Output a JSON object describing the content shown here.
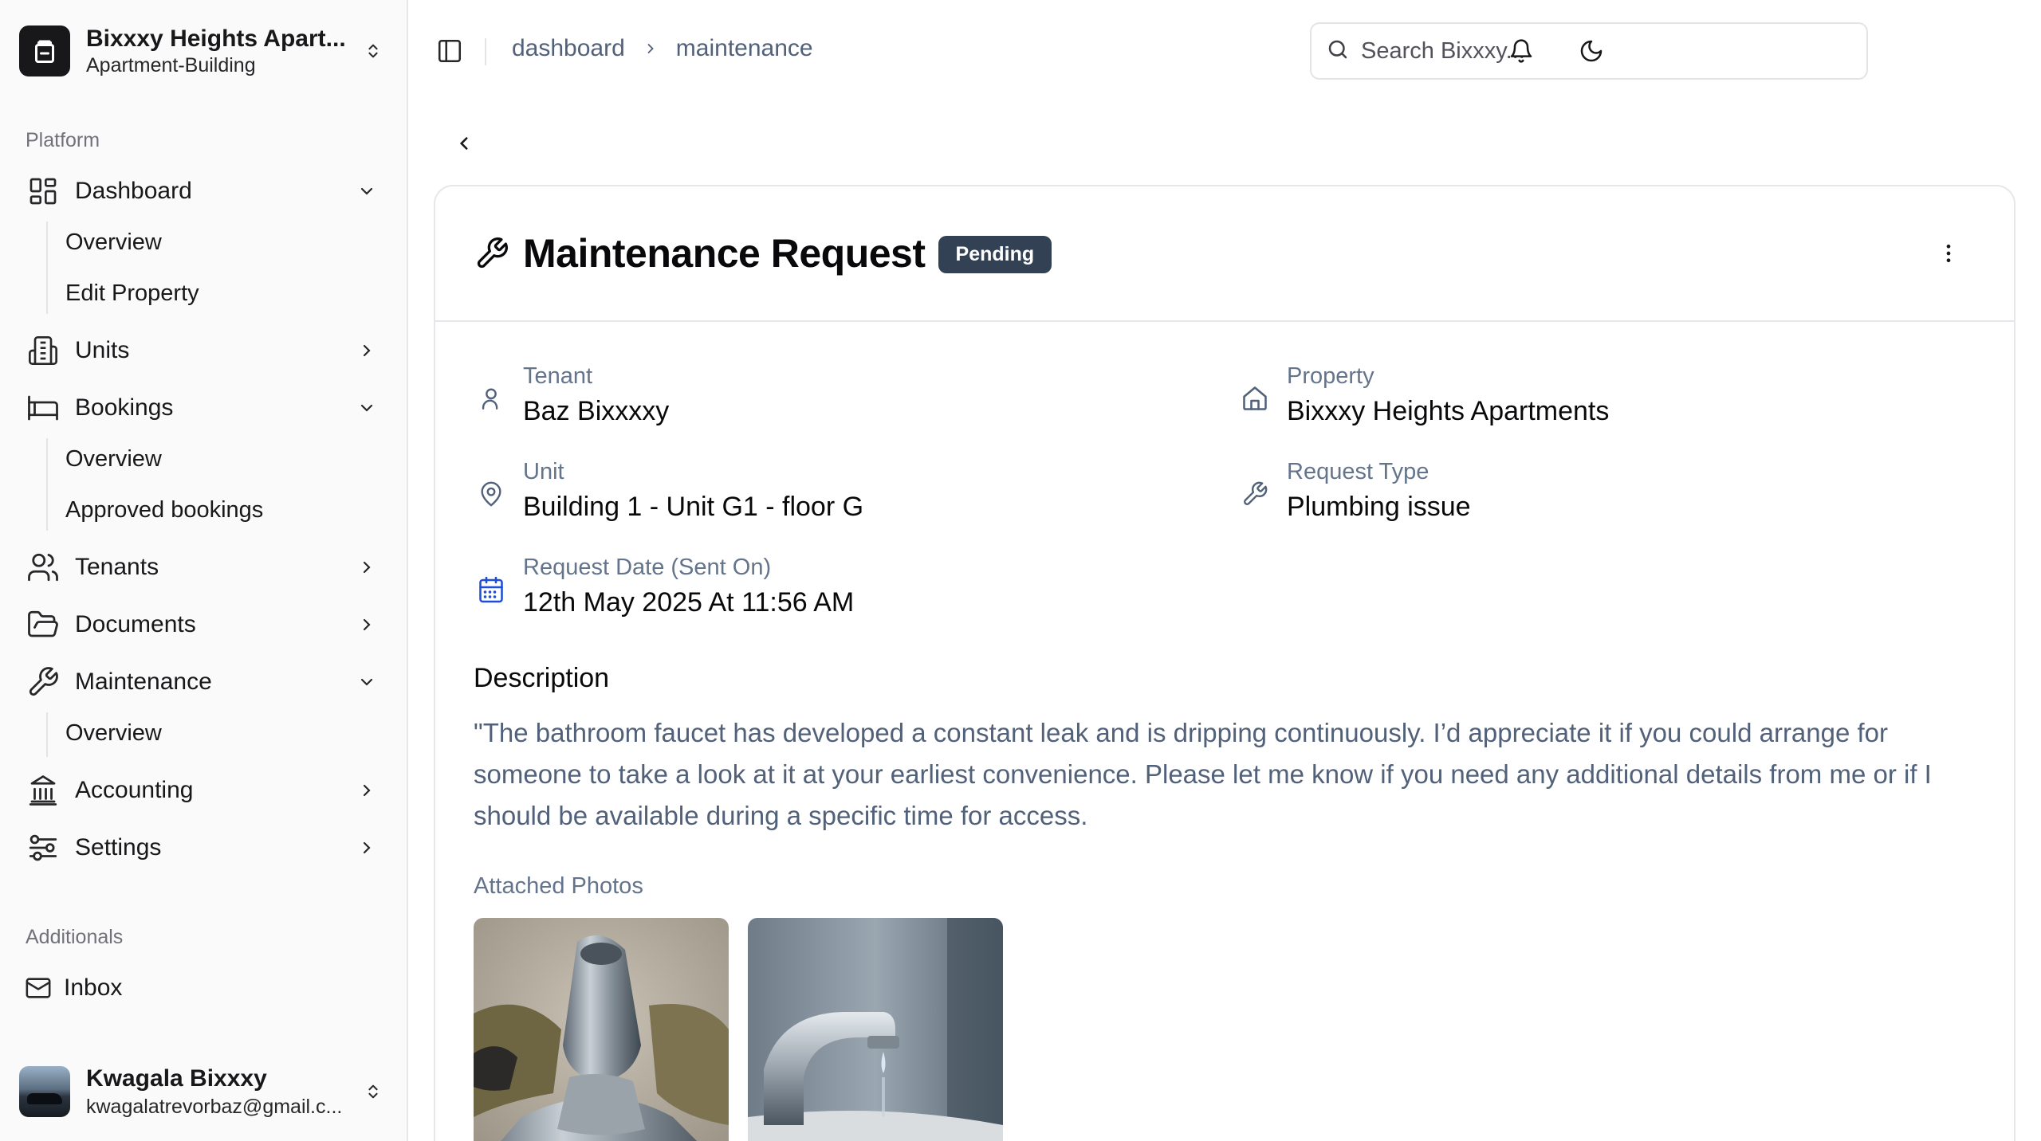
{
  "org": {
    "name": "Bixxxy Heights Apart...",
    "type": "Apartment-Building"
  },
  "sidebar": {
    "platform_label": "Platform",
    "additionals_label": "Additionals",
    "dashboard": {
      "label": "Dashboard",
      "sub": [
        "Overview",
        "Edit Property"
      ]
    },
    "units": {
      "label": "Units"
    },
    "bookings": {
      "label": "Bookings",
      "sub": [
        "Overview",
        "Approved bookings"
      ]
    },
    "tenants": {
      "label": "Tenants"
    },
    "documents": {
      "label": "Documents"
    },
    "maintenance": {
      "label": "Maintenance",
      "sub": [
        "Overview"
      ]
    },
    "accounting": {
      "label": "Accounting"
    },
    "settings": {
      "label": "Settings"
    },
    "inbox": {
      "label": "Inbox"
    }
  },
  "user": {
    "name": "Kwagala Bixxxy",
    "email": "kwagalatrevorbaz@gmail.c..."
  },
  "topbar": {
    "breadcrumb": [
      "dashboard",
      "maintenance"
    ],
    "search_placeholder": "Search Bixxxy..."
  },
  "request": {
    "title": "Maintenance Request",
    "status": "Pending",
    "tenant_label": "Tenant",
    "tenant": "Baz Bixxxxy",
    "property_label": "Property",
    "property": "Bixxxy Heights Apartments",
    "unit_label": "Unit",
    "unit": "Building 1 - Unit G1 - floor G",
    "type_label": "Request Type",
    "type": "Plumbing issue",
    "date_label": "Request Date (Sent On)",
    "date": "12th May 2025 At 11:56 AM",
    "description_label": "Description",
    "description": "\"The bathroom faucet has developed a constant leak and is dripping continuously. I’d appreciate it if you could arrange for someone to take a look at it at your earliest convenience. Please let me know if you need any additional details from me or if I should be available during a specific time for access.",
    "photos_label": "Attached Photos"
  },
  "colors": {
    "badge_bg": "#334155",
    "accent_icon": "#1d4ed8",
    "muted_text": "#52617a"
  }
}
